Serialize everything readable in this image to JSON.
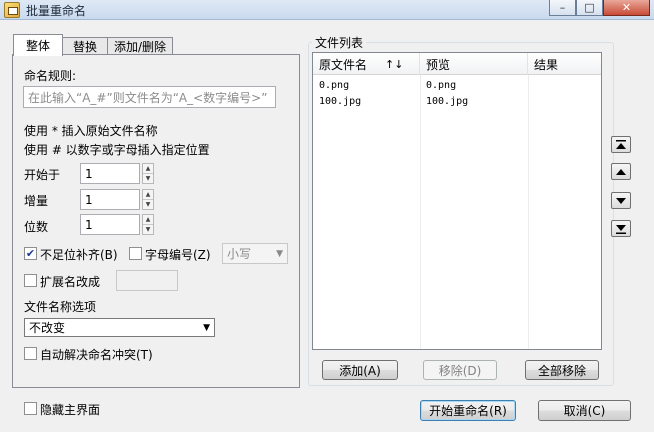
{
  "window": {
    "title": "批量重命名",
    "buttons": {
      "minimize": "–",
      "maximize": "□",
      "close": "✕"
    }
  },
  "tabs": [
    {
      "label": "整体",
      "active": true
    },
    {
      "label": "替换",
      "active": false
    },
    {
      "label": "添加/删除",
      "active": false
    }
  ],
  "rules": {
    "label": "命名规则:",
    "placeholder": "在此输入“A_#”则文件名为“A_<数字编号>”",
    "hint1": "使用 * 插入原始文件名称",
    "hint2": "使用 # 以数字或字母插入指定位置",
    "start_label": "开始于",
    "start_value": "1",
    "step_label": "增量",
    "step_value": "1",
    "digits_label": "位数",
    "digits_value": "1",
    "pad_label": "不足位补齐(B)",
    "pad_checked": true,
    "alpha_label": "字母编号(Z)",
    "alpha_checked": false,
    "case_value": "小写",
    "ext_label": "扩展名改成",
    "ext_checked": false,
    "ext_value": "",
    "name_option_label": "文件名称选项",
    "name_option_value": "不改变",
    "conflict_label": "自动解决命名冲突(T)",
    "conflict_checked": false
  },
  "file_list": {
    "title": "文件列表",
    "columns": [
      "原文件名",
      "预览",
      "结果"
    ],
    "sort_indicator": "↑↓",
    "rows": [
      {
        "original": "0.png",
        "preview": "0.png",
        "result": ""
      },
      {
        "original": "100.jpg",
        "preview": "100.jpg",
        "result": ""
      }
    ],
    "add_button": "添加(A)",
    "remove_button": "移除(D)",
    "remove_all_button": "全部移除"
  },
  "side_buttons": [
    "move-top",
    "move-up",
    "move-down",
    "move-bottom"
  ],
  "footer": {
    "hide_label": "隐藏主界面",
    "hide_checked": false,
    "start_button": "开始重命名(R)",
    "cancel_button": "取消(C)"
  },
  "colors": {
    "title_bar": "#c9d9ee",
    "close_button": "#c84b36",
    "window_bg": "#f0f0f0"
  }
}
